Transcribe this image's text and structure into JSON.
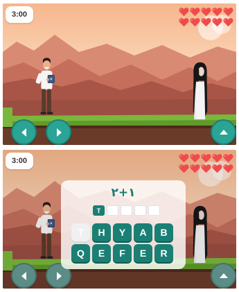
{
  "colors": {
    "accent": "#2aa495",
    "tile": "#1a7f74",
    "heart": "#ef4b4b",
    "sky": "#f3c9a6",
    "grass": "#7ab73c"
  },
  "top_panel": {
    "timer": "3:00",
    "hearts": 10,
    "buttons": {
      "left": "arrow-left-icon",
      "right": "arrow-right-icon",
      "jump": "arrow-up-icon"
    }
  },
  "bottom_panel": {
    "timer": "3:00",
    "hearts": 10,
    "quiz": {
      "question": "١+٢",
      "answer_slots": [
        "T",
        "",
        "",
        "",
        ""
      ],
      "row1": [
        {
          "letter": "T",
          "used": true
        },
        {
          "letter": "H",
          "used": false
        },
        {
          "letter": "Y",
          "used": false
        },
        {
          "letter": "A",
          "used": false
        },
        {
          "letter": "B",
          "used": false
        }
      ],
      "row2": [
        {
          "letter": "Q",
          "used": false
        },
        {
          "letter": "E",
          "used": false
        },
        {
          "letter": "F",
          "used": false
        },
        {
          "letter": "E",
          "used": false
        },
        {
          "letter": "R",
          "used": false
        }
      ]
    }
  }
}
